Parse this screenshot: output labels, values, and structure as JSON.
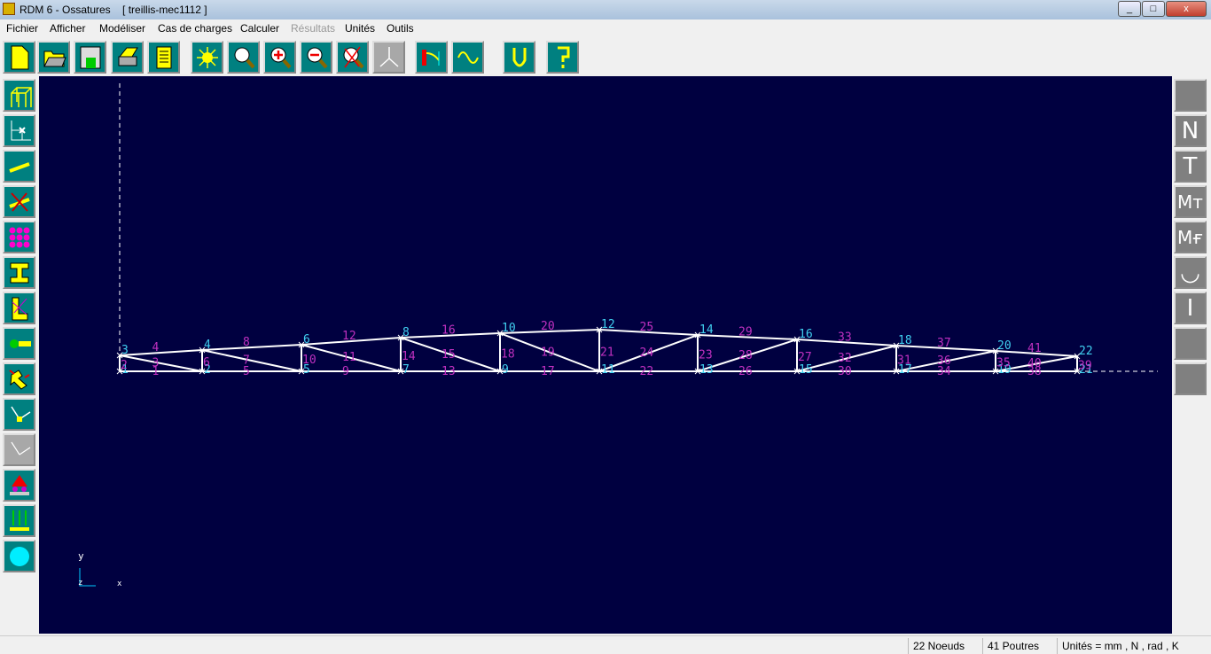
{
  "window": {
    "title": "RDM 6 - Ossatures",
    "document": "[ treillis-mec1112 ]",
    "minimize": "_",
    "maximize": "□",
    "close": "x"
  },
  "menu": [
    "Fichier",
    "Afficher",
    "Modéliser",
    "Cas de charges",
    "Calculer",
    "Résultats",
    "Unités",
    "Outils"
  ],
  "right_toolbar": [
    "",
    "N",
    "T",
    "Mт",
    "Mғ",
    "◡",
    "Ⅰ",
    "",
    ""
  ],
  "axes": {
    "y": "y",
    "z": "z",
    "x": "x"
  },
  "truss": {
    "node_color": "#40d0f0",
    "beam_color": "#c030c0",
    "bottom_nodes": [
      "1",
      "2",
      "5",
      "7",
      "9",
      "11",
      "13",
      "15",
      "17",
      "19",
      "21"
    ],
    "top_nodes": [
      "3",
      "4",
      "6",
      "8",
      "10",
      "12",
      "14",
      "16",
      "18",
      "20",
      "22"
    ],
    "bottom_beams": [
      "1",
      "5",
      "9",
      "13",
      "17",
      "22",
      "26",
      "30",
      "34",
      "38"
    ],
    "top_beams": [
      "4",
      "8",
      "12",
      "16",
      "20",
      "25",
      "29",
      "33",
      "37",
      "41"
    ],
    "vertical_beams": [
      "2",
      "6",
      "10",
      "14",
      "18",
      "21",
      "23",
      "27",
      "31",
      "35",
      "39"
    ],
    "diagonal_beams": [
      "3",
      "7",
      "11",
      "15",
      "19",
      "24",
      "28",
      "32",
      "36",
      "40"
    ]
  },
  "status": {
    "nodes": "22 Noeuds",
    "beams": "41 Poutres",
    "units": "Unités = mm , N , rad , K"
  }
}
